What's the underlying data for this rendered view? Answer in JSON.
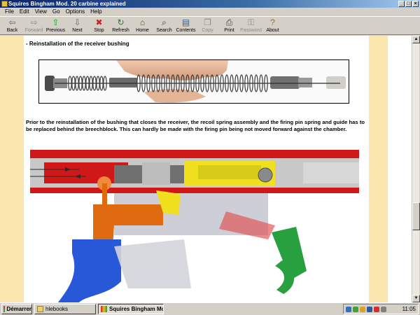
{
  "window": {
    "title": "Squires Bingham Mod. 20 carbine explained",
    "controls": [
      "_",
      "□",
      "×"
    ]
  },
  "menu": [
    "File",
    "Edit",
    "View",
    "Go",
    "Options",
    "Help"
  ],
  "toolbar": [
    {
      "label": "Back",
      "icon": "back-arrow-icon",
      "glyph": "⇦",
      "color": "#1f6fc0",
      "enabled": true
    },
    {
      "label": "Forward",
      "icon": "forward-arrow-icon",
      "glyph": "⇨",
      "color": "#8a8a8a",
      "enabled": false
    },
    {
      "label": "Previous",
      "icon": "up-arrow-icon",
      "glyph": "⇧",
      "color": "#2a9a2a",
      "enabled": true
    },
    {
      "label": "Next",
      "icon": "down-arrow-icon",
      "glyph": "⇩",
      "color": "#2a9a2a",
      "enabled": true
    },
    {
      "label": "Stop",
      "icon": "stop-icon",
      "glyph": "✖",
      "color": "#d02020",
      "enabled": true
    },
    {
      "label": "Refresh",
      "icon": "refresh-icon",
      "glyph": "↻",
      "color": "#2a7a2a",
      "enabled": true
    },
    {
      "label": "Home",
      "icon": "home-icon",
      "glyph": "⌂",
      "color": "#7a4a10",
      "enabled": true
    },
    {
      "label": "Search",
      "icon": "search-icon",
      "glyph": "⌕",
      "color": "#333333",
      "enabled": true
    },
    {
      "label": "Contents",
      "icon": "contents-icon",
      "glyph": "▤",
      "color": "#3060a0",
      "enabled": true
    },
    {
      "label": "Copy",
      "icon": "copy-icon",
      "glyph": "❐",
      "color": "#8a8a8a",
      "enabled": false
    },
    {
      "label": "Print",
      "icon": "print-icon",
      "glyph": "⎙",
      "color": "#404040",
      "enabled": true
    },
    {
      "label": "Password",
      "icon": "key-icon",
      "glyph": "⚿",
      "color": "#8a8a8a",
      "enabled": false
    },
    {
      "label": "About",
      "icon": "about-icon",
      "glyph": "?",
      "color": "#a07010",
      "enabled": true
    }
  ],
  "page": {
    "heading": "- Reinstallation of the receiver bushing",
    "paragraph": "Prior to the reinstallation of the bushing that closes the receiver, the recoil spring assembly and the firing pin spring and guide has to be replaced behind the breechblock. This can hardly be made with the firing pin being not moved forward against the chamber."
  },
  "colors": {
    "side_pane": "#fbe7ad",
    "receiver_red": "#d01818",
    "bolt_yellow": "#f0e020",
    "hammer_orange": "#e06a10",
    "trigger_green": "#28a040",
    "grip_blue": "#2858d8"
  },
  "taskbar": {
    "start_label": "Démarrer",
    "tasks": [
      {
        "label": "hlebooks",
        "icon": "folder-icon",
        "active": false
      },
      {
        "label": "Squires Bingham Mod...",
        "icon": "ebook-icon",
        "active": true
      }
    ],
    "clock": "11:05"
  }
}
